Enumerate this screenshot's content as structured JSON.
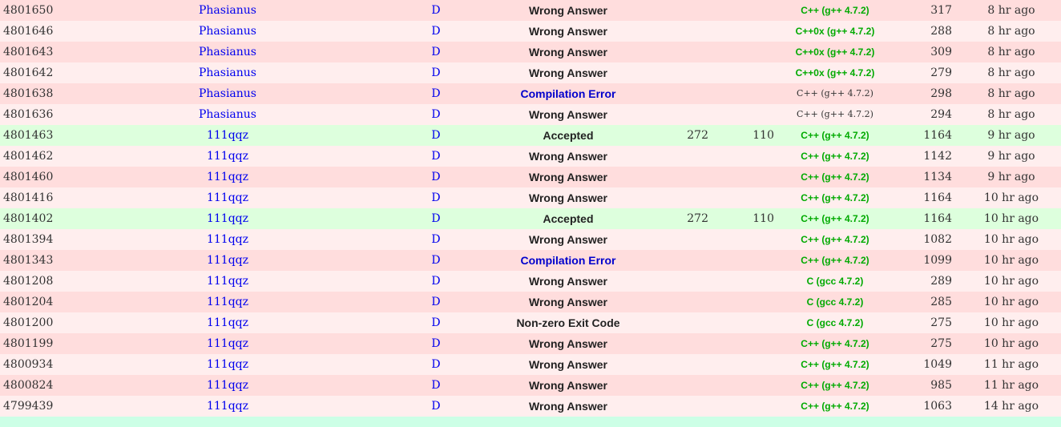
{
  "colors": {
    "row_even": "#ffdddd",
    "row_odd": "#ffeeee",
    "row_accepted": "#ddffdd",
    "link_blue": "#0000ee",
    "lang_green": "#00aa00",
    "footer_bar": "#ccffe6"
  },
  "rows": [
    {
      "run_id": "4801650",
      "user": "Phasianus",
      "problem": "D",
      "status": "Wrong Answer",
      "time": "",
      "memory": "",
      "language": "C++ (g++ 4.7.2)",
      "lang_style": "green",
      "length": "317",
      "submit_time": "8 hr ago"
    },
    {
      "run_id": "4801646",
      "user": "Phasianus",
      "problem": "D",
      "status": "Wrong Answer",
      "time": "",
      "memory": "",
      "language": "C++0x (g++ 4.7.2)",
      "lang_style": "green",
      "length": "288",
      "submit_time": "8 hr ago"
    },
    {
      "run_id": "4801643",
      "user": "Phasianus",
      "problem": "D",
      "status": "Wrong Answer",
      "time": "",
      "memory": "",
      "language": "C++0x (g++ 4.7.2)",
      "lang_style": "green",
      "length": "309",
      "submit_time": "8 hr ago"
    },
    {
      "run_id": "4801642",
      "user": "Phasianus",
      "problem": "D",
      "status": "Wrong Answer",
      "time": "",
      "memory": "",
      "language": "C++0x (g++ 4.7.2)",
      "lang_style": "green",
      "length": "279",
      "submit_time": "8 hr ago"
    },
    {
      "run_id": "4801638",
      "user": "Phasianus",
      "problem": "D",
      "status": "Compilation Error",
      "time": "",
      "memory": "",
      "language": "C++ (g++ 4.7.2)",
      "lang_style": "plain",
      "length": "298",
      "submit_time": "8 hr ago"
    },
    {
      "run_id": "4801636",
      "user": "Phasianus",
      "problem": "D",
      "status": "Wrong Answer",
      "time": "",
      "memory": "",
      "language": "C++ (g++ 4.7.2)",
      "lang_style": "plain",
      "length": "294",
      "submit_time": "8 hr ago"
    },
    {
      "run_id": "4801463",
      "user": "111qqz",
      "problem": "D",
      "status": "Accepted",
      "time": "272",
      "memory": "110",
      "language": "C++ (g++ 4.7.2)",
      "lang_style": "green",
      "length": "1164",
      "submit_time": "9 hr ago"
    },
    {
      "run_id": "4801462",
      "user": "111qqz",
      "problem": "D",
      "status": "Wrong Answer",
      "time": "",
      "memory": "",
      "language": "C++ (g++ 4.7.2)",
      "lang_style": "green",
      "length": "1142",
      "submit_time": "9 hr ago"
    },
    {
      "run_id": "4801460",
      "user": "111qqz",
      "problem": "D",
      "status": "Wrong Answer",
      "time": "",
      "memory": "",
      "language": "C++ (g++ 4.7.2)",
      "lang_style": "green",
      "length": "1134",
      "submit_time": "9 hr ago"
    },
    {
      "run_id": "4801416",
      "user": "111qqz",
      "problem": "D",
      "status": "Wrong Answer",
      "time": "",
      "memory": "",
      "language": "C++ (g++ 4.7.2)",
      "lang_style": "green",
      "length": "1164",
      "submit_time": "10 hr ago"
    },
    {
      "run_id": "4801402",
      "user": "111qqz",
      "problem": "D",
      "status": "Accepted",
      "time": "272",
      "memory": "110",
      "language": "C++ (g++ 4.7.2)",
      "lang_style": "green",
      "length": "1164",
      "submit_time": "10 hr ago"
    },
    {
      "run_id": "4801394",
      "user": "111qqz",
      "problem": "D",
      "status": "Wrong Answer",
      "time": "",
      "memory": "",
      "language": "C++ (g++ 4.7.2)",
      "lang_style": "green",
      "length": "1082",
      "submit_time": "10 hr ago"
    },
    {
      "run_id": "4801343",
      "user": "111qqz",
      "problem": "D",
      "status": "Compilation Error",
      "time": "",
      "memory": "",
      "language": "C++ (g++ 4.7.2)",
      "lang_style": "green",
      "length": "1099",
      "submit_time": "10 hr ago"
    },
    {
      "run_id": "4801208",
      "user": "111qqz",
      "problem": "D",
      "status": "Wrong Answer",
      "time": "",
      "memory": "",
      "language": "C (gcc 4.7.2)",
      "lang_style": "green",
      "length": "289",
      "submit_time": "10 hr ago"
    },
    {
      "run_id": "4801204",
      "user": "111qqz",
      "problem": "D",
      "status": "Wrong Answer",
      "time": "",
      "memory": "",
      "language": "C (gcc 4.7.2)",
      "lang_style": "green",
      "length": "285",
      "submit_time": "10 hr ago"
    },
    {
      "run_id": "4801200",
      "user": "111qqz",
      "problem": "D",
      "status": "Non-zero Exit Code",
      "time": "",
      "memory": "",
      "language": "C (gcc 4.7.2)",
      "lang_style": "green",
      "length": "275",
      "submit_time": "10 hr ago"
    },
    {
      "run_id": "4801199",
      "user": "111qqz",
      "problem": "D",
      "status": "Wrong Answer",
      "time": "",
      "memory": "",
      "language": "C++ (g++ 4.7.2)",
      "lang_style": "green",
      "length": "275",
      "submit_time": "10 hr ago"
    },
    {
      "run_id": "4800934",
      "user": "111qqz",
      "problem": "D",
      "status": "Wrong Answer",
      "time": "",
      "memory": "",
      "language": "C++ (g++ 4.7.2)",
      "lang_style": "green",
      "length": "1049",
      "submit_time": "11 hr ago"
    },
    {
      "run_id": "4800824",
      "user": "111qqz",
      "problem": "D",
      "status": "Wrong Answer",
      "time": "",
      "memory": "",
      "language": "C++ (g++ 4.7.2)",
      "lang_style": "green",
      "length": "985",
      "submit_time": "11 hr ago"
    },
    {
      "run_id": "4799439",
      "user": "111qqz",
      "problem": "D",
      "status": "Wrong Answer",
      "time": "",
      "memory": "",
      "language": "C++ (g++ 4.7.2)",
      "lang_style": "green",
      "length": "1063",
      "submit_time": "14 hr ago"
    }
  ]
}
